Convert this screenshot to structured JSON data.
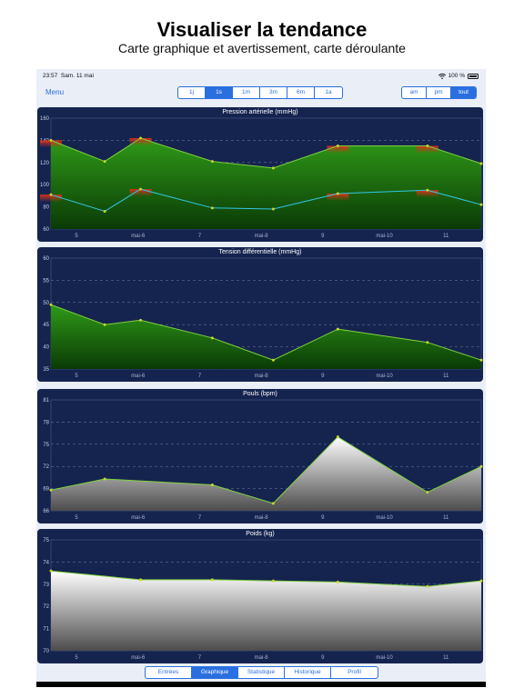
{
  "headline": "Visualiser la tendance",
  "subline": "Carte graphique et avertissement, carte déroulante",
  "status": {
    "time": "23:57",
    "date": "Sam. 11 mai",
    "battery": "100 %"
  },
  "nav": {
    "menu": "Menu",
    "periods": [
      "1j",
      "1s",
      "1m",
      "3m",
      "6m",
      "1a"
    ],
    "period_selected": "1s",
    "times": [
      "am",
      "pm",
      "tout"
    ],
    "time_selected": "tout"
  },
  "tabs": [
    "Entrées",
    "Graphique",
    "Statistique",
    "Historique",
    "Profil"
  ],
  "tab_selected": "Graphique",
  "colors": {
    "panel_bg": "#15234f",
    "accent": "#2a6fe0",
    "line_green": "#7fd23c",
    "line_cyan": "#33c6e6",
    "warn_red": "#d8301a"
  },
  "chart_data": [
    {
      "type": "area",
      "title": "Pression artérielle (mmHg)",
      "x_tick_labels": [
        "5",
        "mai-6",
        "7",
        "mai-8",
        "9",
        "mai-10",
        "11"
      ],
      "x": [
        4.5,
        5.25,
        5.75,
        6.75,
        7.6,
        8.5,
        9.75,
        10.5
      ],
      "ylim": [
        60,
        160
      ],
      "yticks": [
        60,
        80,
        100,
        120,
        140,
        160
      ],
      "grid": true,
      "series": [
        {
          "values": [
            140,
            121,
            142,
            121,
            115,
            135,
            135,
            119
          ]
        },
        {
          "values": [
            91,
            76,
            96,
            79,
            78,
            92,
            95,
            82
          ]
        }
      ]
    },
    {
      "type": "area",
      "title": "Tension différentielle (mmHg)",
      "x_tick_labels": [
        "5",
        "mai-6",
        "7",
        "mai-8",
        "9",
        "mai-10",
        "11"
      ],
      "x": [
        4.5,
        5.25,
        5.75,
        6.75,
        7.6,
        8.5,
        9.75,
        10.5
      ],
      "ylim": [
        35,
        60
      ],
      "yticks": [
        35,
        40,
        45,
        50,
        55,
        60
      ],
      "grid": true,
      "series": [
        {
          "values": [
            49.5,
            45,
            46,
            42,
            37,
            44,
            41,
            37
          ]
        }
      ]
    },
    {
      "type": "area",
      "title": "Pouls (bpm)",
      "x_tick_labels": [
        "5",
        "mai-6",
        "7",
        "mai-8",
        "9",
        "mai-10",
        "11"
      ],
      "x": [
        4.5,
        5.25,
        6.75,
        7.6,
        8.5,
        9.75,
        10.5
      ],
      "ylim": [
        66,
        81
      ],
      "yticks": [
        66,
        69,
        72,
        75,
        78,
        81
      ],
      "grid": true,
      "series": [
        {
          "values": [
            68.8,
            70.3,
            69.5,
            67,
            76,
            68.5,
            72
          ]
        }
      ]
    },
    {
      "type": "area",
      "title": "Poids (kg)",
      "x_tick_labels": [
        "5",
        "mai-6",
        "7",
        "mai-8",
        "9",
        "mai-10",
        "11"
      ],
      "x": [
        4.5,
        5.75,
        6.75,
        7.6,
        8.5,
        9.75,
        10.5
      ],
      "ylim": [
        70,
        75
      ],
      "yticks": [
        70,
        71,
        72,
        73,
        74,
        75
      ],
      "grid": true,
      "series": [
        {
          "values": [
            73.6,
            73.2,
            73.2,
            73.15,
            73.1,
            72.9,
            73.15
          ]
        }
      ]
    }
  ]
}
